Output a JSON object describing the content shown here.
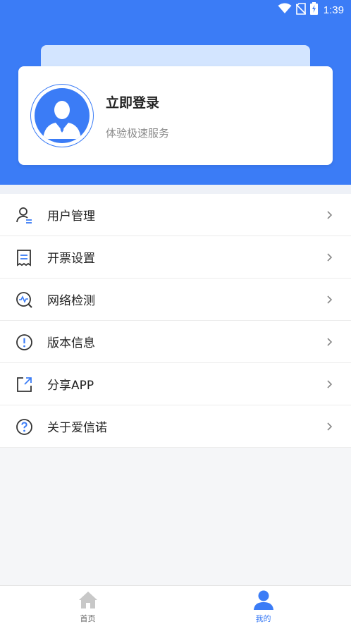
{
  "status_bar": {
    "time": "1:39",
    "icons": [
      "wifi-icon",
      "no-sim-icon",
      "battery-charging-icon"
    ]
  },
  "profile_card": {
    "title": "立即登录",
    "subtitle": "体验极速服务",
    "avatar_icon": "user-avatar-icon"
  },
  "menu": {
    "items": [
      {
        "label": "用户管理",
        "icon": "user-manage-icon"
      },
      {
        "label": "开票设置",
        "icon": "invoice-icon"
      },
      {
        "label": "网络检测",
        "icon": "network-check-icon"
      },
      {
        "label": "版本信息",
        "icon": "info-icon"
      },
      {
        "label": "分享APP",
        "icon": "share-icon"
      },
      {
        "label": "关于爱信诺",
        "icon": "help-icon"
      }
    ]
  },
  "tabbar": {
    "tabs": [
      {
        "label": "首页",
        "icon": "home-icon",
        "active": false
      },
      {
        "label": "我的",
        "icon": "person-icon",
        "active": true
      }
    ]
  },
  "colors": {
    "primary": "#3b7cf6",
    "card_back": "#d3e5ff",
    "text": "#222222",
    "subtext": "#8a8a8a",
    "inactive_tab": "#c8c8c8"
  }
}
